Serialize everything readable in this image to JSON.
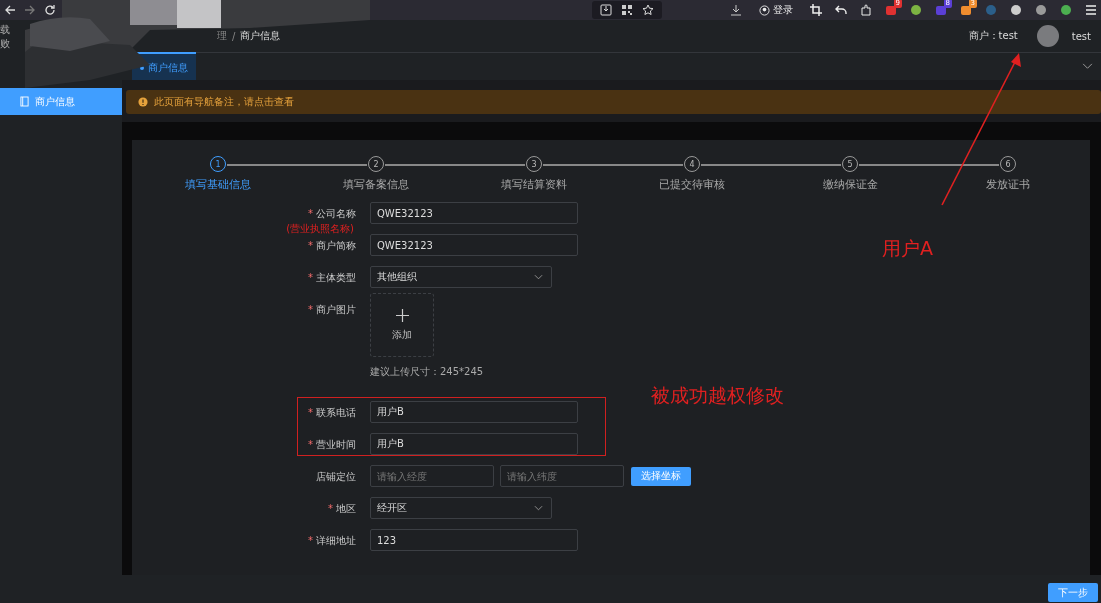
{
  "browser": {
    "login": "登录",
    "extensions": [
      {
        "kind": "crop"
      },
      {
        "kind": "undo"
      },
      {
        "kind": "puzzle"
      },
      {
        "kind": "badge",
        "badge": "9",
        "color": "#e03131"
      },
      {
        "kind": "circle",
        "color": "#7cb342"
      },
      {
        "kind": "badge",
        "badge": "8",
        "color": "#5b3fd6"
      },
      {
        "kind": "badge",
        "badge": "3",
        "color": "#f08c2e"
      },
      {
        "kind": "circle",
        "color": "#2b5f8a"
      },
      {
        "kind": "circle",
        "color": "#cccccc"
      },
      {
        "kind": "circle",
        "color": "#9a9a9a"
      },
      {
        "kind": "circle",
        "color": "#4caf50"
      },
      {
        "kind": "menu"
      }
    ]
  },
  "sidebar": {
    "fragments": [
      "载",
      "败"
    ],
    "items": [
      {
        "label": "商户信息",
        "selected": true
      }
    ]
  },
  "header": {
    "breadcrumb": [
      "理",
      "商户信息"
    ],
    "separator": "/",
    "merchant": "商户：test",
    "user": "test"
  },
  "tabs": [
    {
      "label": "商户信息",
      "selected": true
    }
  ],
  "notice": {
    "text": "此页面有导航备注，请点击查看"
  },
  "steps": [
    {
      "number": "1",
      "label": "填写基础信息",
      "selected": true
    },
    {
      "number": "2",
      "label": "填写备案信息",
      "selected": false
    },
    {
      "number": "3",
      "label": "填写结算资料",
      "selected": false
    },
    {
      "number": "4",
      "label": "已提交待审核",
      "selected": false
    },
    {
      "number": "5",
      "label": "缴纳保证金",
      "selected": false
    },
    {
      "number": "6",
      "label": "发放证书",
      "selected": false
    }
  ],
  "required_mark": "*",
  "form": [
    {
      "kind": "input",
      "label": "公司名称",
      "required": true,
      "note": "(营业执照名称)",
      "value": "QWE32123"
    },
    {
      "kind": "input",
      "label": "商户简称",
      "required": true,
      "value": "QWE32123"
    },
    {
      "kind": "select",
      "label": "主体类型",
      "required": true,
      "value": "其他组织"
    },
    {
      "kind": "upload",
      "label": "商户图片",
      "required": true,
      "button": "添加",
      "hint": "建议上传尺寸：245*245"
    },
    {
      "kind": "input",
      "label": "联系电话",
      "required": true,
      "value": "用户B"
    },
    {
      "kind": "input",
      "label": "营业时间",
      "required": true,
      "value": "用户B"
    },
    {
      "kind": "coords",
      "label": "店铺定位",
      "required": false,
      "placeholder_1": "请输入经度",
      "placeholder_2": "请输入纬度",
      "button": "选择坐标"
    },
    {
      "kind": "select",
      "label": "地区",
      "required": true,
      "value": "经开区"
    },
    {
      "kind": "input",
      "label": "详细地址",
      "required": true,
      "value": "123"
    }
  ],
  "footer": {
    "next": "下一步"
  },
  "annotations": {
    "user_a": "用户A",
    "modified": "被成功越权修改"
  }
}
